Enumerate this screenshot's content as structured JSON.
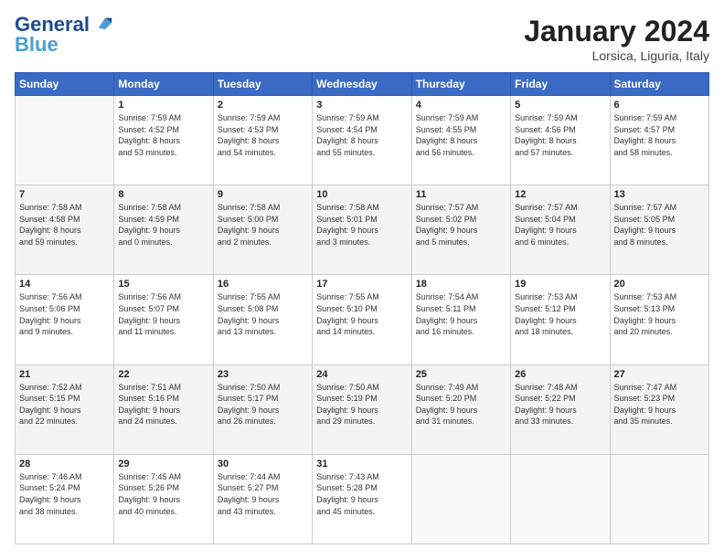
{
  "logo": {
    "line1": "General",
    "line2": "Blue"
  },
  "title": "January 2024",
  "subtitle": "Lorsica, Liguria, Italy",
  "columns": [
    "Sunday",
    "Monday",
    "Tuesday",
    "Wednesday",
    "Thursday",
    "Friday",
    "Saturday"
  ],
  "weeks": [
    [
      {
        "day": "",
        "info": ""
      },
      {
        "day": "1",
        "info": "Sunrise: 7:59 AM\nSunset: 4:52 PM\nDaylight: 8 hours\nand 53 minutes."
      },
      {
        "day": "2",
        "info": "Sunrise: 7:59 AM\nSunset: 4:53 PM\nDaylight: 8 hours\nand 54 minutes."
      },
      {
        "day": "3",
        "info": "Sunrise: 7:59 AM\nSunset: 4:54 PM\nDaylight: 8 hours\nand 55 minutes."
      },
      {
        "day": "4",
        "info": "Sunrise: 7:59 AM\nSunset: 4:55 PM\nDaylight: 8 hours\nand 56 minutes."
      },
      {
        "day": "5",
        "info": "Sunrise: 7:59 AM\nSunset: 4:56 PM\nDaylight: 8 hours\nand 57 minutes."
      },
      {
        "day": "6",
        "info": "Sunrise: 7:59 AM\nSunset: 4:57 PM\nDaylight: 8 hours\nand 58 minutes."
      }
    ],
    [
      {
        "day": "7",
        "info": "Sunrise: 7:58 AM\nSunset: 4:58 PM\nDaylight: 8 hours\nand 59 minutes."
      },
      {
        "day": "8",
        "info": "Sunrise: 7:58 AM\nSunset: 4:59 PM\nDaylight: 9 hours\nand 0 minutes."
      },
      {
        "day": "9",
        "info": "Sunrise: 7:58 AM\nSunset: 5:00 PM\nDaylight: 9 hours\nand 2 minutes."
      },
      {
        "day": "10",
        "info": "Sunrise: 7:58 AM\nSunset: 5:01 PM\nDaylight: 9 hours\nand 3 minutes."
      },
      {
        "day": "11",
        "info": "Sunrise: 7:57 AM\nSunset: 5:02 PM\nDaylight: 9 hours\nand 5 minutes."
      },
      {
        "day": "12",
        "info": "Sunrise: 7:57 AM\nSunset: 5:04 PM\nDaylight: 9 hours\nand 6 minutes."
      },
      {
        "day": "13",
        "info": "Sunrise: 7:57 AM\nSunset: 5:05 PM\nDaylight: 9 hours\nand 8 minutes."
      }
    ],
    [
      {
        "day": "14",
        "info": "Sunrise: 7:56 AM\nSunset: 5:06 PM\nDaylight: 9 hours\nand 9 minutes."
      },
      {
        "day": "15",
        "info": "Sunrise: 7:56 AM\nSunset: 5:07 PM\nDaylight: 9 hours\nand 11 minutes."
      },
      {
        "day": "16",
        "info": "Sunrise: 7:55 AM\nSunset: 5:08 PM\nDaylight: 9 hours\nand 13 minutes."
      },
      {
        "day": "17",
        "info": "Sunrise: 7:55 AM\nSunset: 5:10 PM\nDaylight: 9 hours\nand 14 minutes."
      },
      {
        "day": "18",
        "info": "Sunrise: 7:54 AM\nSunset: 5:11 PM\nDaylight: 9 hours\nand 16 minutes."
      },
      {
        "day": "19",
        "info": "Sunrise: 7:53 AM\nSunset: 5:12 PM\nDaylight: 9 hours\nand 18 minutes."
      },
      {
        "day": "20",
        "info": "Sunrise: 7:53 AM\nSunset: 5:13 PM\nDaylight: 9 hours\nand 20 minutes."
      }
    ],
    [
      {
        "day": "21",
        "info": "Sunrise: 7:52 AM\nSunset: 5:15 PM\nDaylight: 9 hours\nand 22 minutes."
      },
      {
        "day": "22",
        "info": "Sunrise: 7:51 AM\nSunset: 5:16 PM\nDaylight: 9 hours\nand 24 minutes."
      },
      {
        "day": "23",
        "info": "Sunrise: 7:50 AM\nSunset: 5:17 PM\nDaylight: 9 hours\nand 26 minutes."
      },
      {
        "day": "24",
        "info": "Sunrise: 7:50 AM\nSunset: 5:19 PM\nDaylight: 9 hours\nand 29 minutes."
      },
      {
        "day": "25",
        "info": "Sunrise: 7:49 AM\nSunset: 5:20 PM\nDaylight: 9 hours\nand 31 minutes."
      },
      {
        "day": "26",
        "info": "Sunrise: 7:48 AM\nSunset: 5:22 PM\nDaylight: 9 hours\nand 33 minutes."
      },
      {
        "day": "27",
        "info": "Sunrise: 7:47 AM\nSunset: 5:23 PM\nDaylight: 9 hours\nand 35 minutes."
      }
    ],
    [
      {
        "day": "28",
        "info": "Sunrise: 7:46 AM\nSunset: 5:24 PM\nDaylight: 9 hours\nand 38 minutes."
      },
      {
        "day": "29",
        "info": "Sunrise: 7:45 AM\nSunset: 5:26 PM\nDaylight: 9 hours\nand 40 minutes."
      },
      {
        "day": "30",
        "info": "Sunrise: 7:44 AM\nSunset: 5:27 PM\nDaylight: 9 hours\nand 43 minutes."
      },
      {
        "day": "31",
        "info": "Sunrise: 7:43 AM\nSunset: 5:28 PM\nDaylight: 9 hours\nand 45 minutes."
      },
      {
        "day": "",
        "info": ""
      },
      {
        "day": "",
        "info": ""
      },
      {
        "day": "",
        "info": ""
      }
    ]
  ]
}
